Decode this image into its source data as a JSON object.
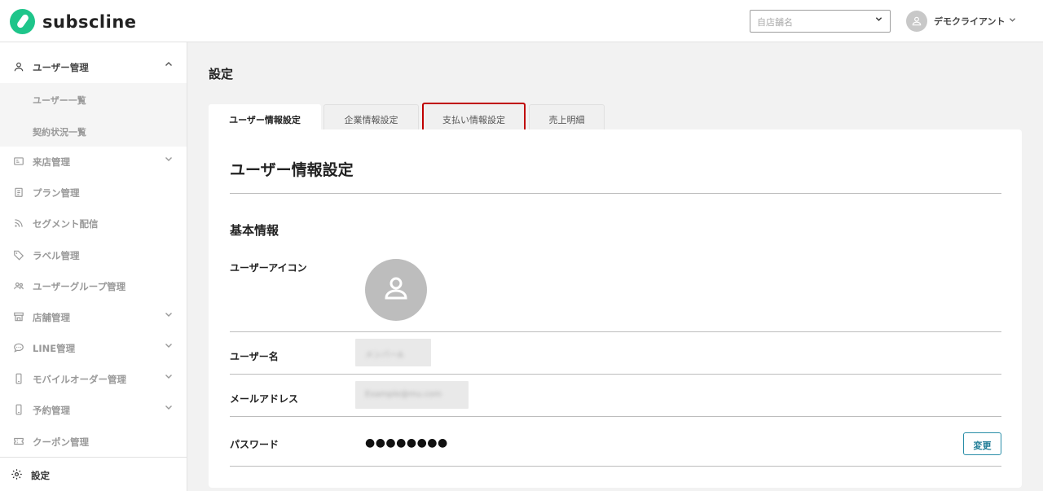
{
  "header": {
    "logo_text": "subscline",
    "store_select_placeholder": "自店舗名",
    "user_name": "デモクライアント"
  },
  "sidebar": {
    "user_mgmt": "ユーザー管理",
    "user_list": "ユーザー一覧",
    "contract_list": "契約状況一覧",
    "visit_mgmt": "来店管理",
    "plan_mgmt": "プラン管理",
    "segment": "セグメント配信",
    "label_mgmt": "ラベル管理",
    "user_group": "ユーザーグループ管理",
    "store_mgmt": "店舗管理",
    "line_mgmt": "LINE管理",
    "mobile_order": "モバイルオーダー管理",
    "reservation": "予約管理",
    "coupon": "クーポン管理",
    "settings": "設定"
  },
  "main": {
    "page_title": "設定",
    "tabs": [
      "ユーザー情報設定",
      "企業情報設定",
      "支払い情報設定",
      "売上明細"
    ],
    "card_title": "ユーザー情報設定",
    "section_title": "基本情報",
    "fields": {
      "icon_label": "ユーザーアイコン",
      "username_label": "ユーザー名",
      "username_value": "メンバーA",
      "email_label": "メールアドレス",
      "email_value": "Example@mu.com",
      "password_label": "パスワード",
      "password_value": "●●●●●●●●",
      "change_button": "変更"
    }
  },
  "colors": {
    "brand": "#1ec58a",
    "highlight_border": "#c00000",
    "button_accent": "#2a8ea8"
  }
}
